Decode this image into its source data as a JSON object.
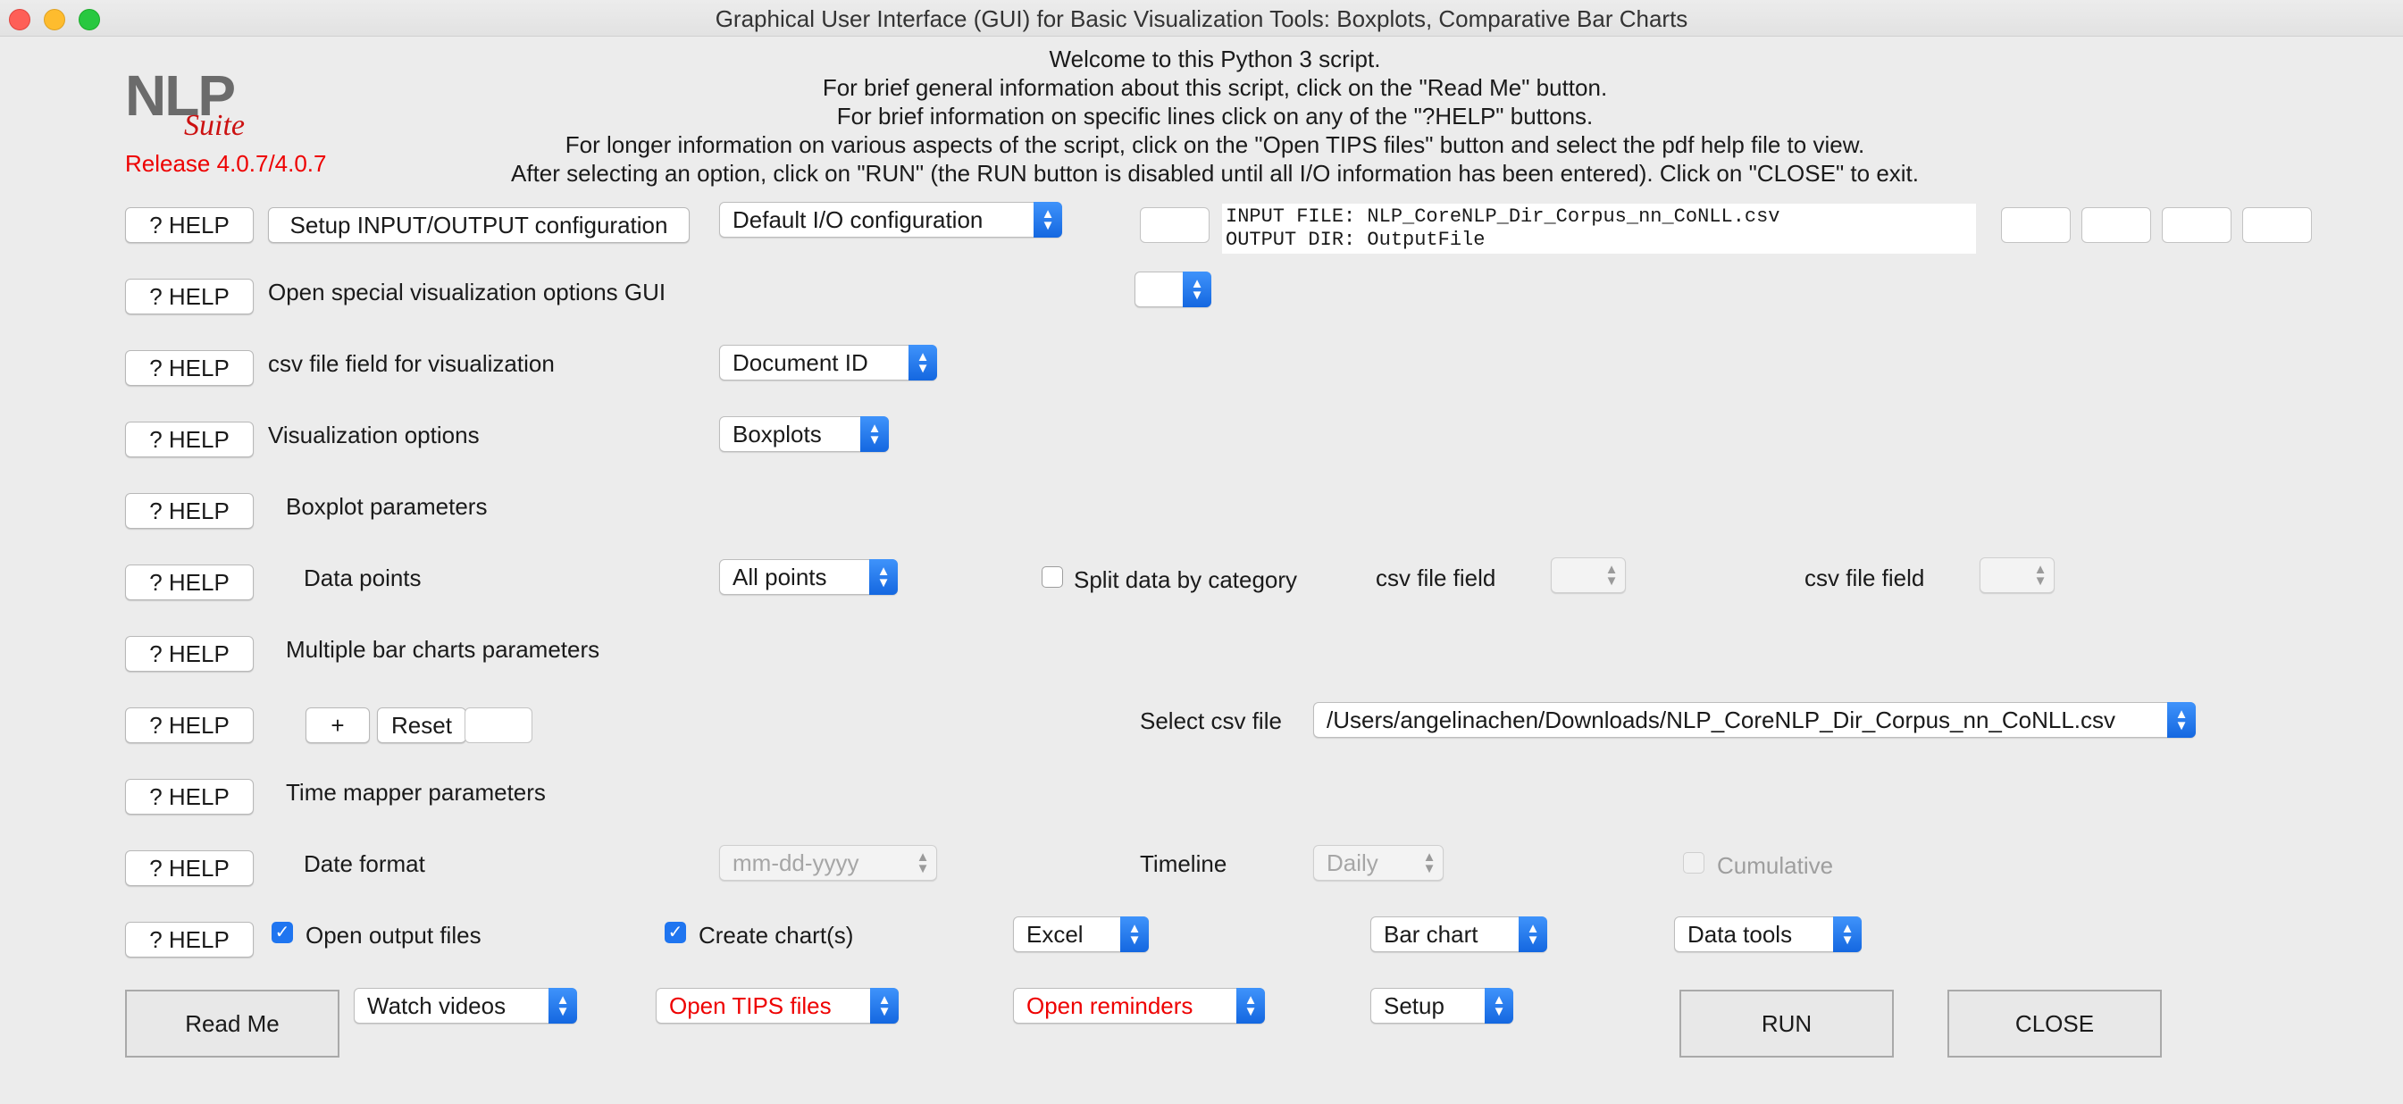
{
  "window": {
    "title": "Graphical User Interface (GUI) for Basic Visualization Tools: Boxplots, Comparative Bar Charts"
  },
  "logo": {
    "nlp": "NLP",
    "suite": "Suite"
  },
  "release": "Release 4.0.7/4.0.7",
  "header_lines": [
    "Welcome to this Python 3 script.",
    "For brief general information about this script, click on the \"Read Me\" button.",
    "For brief information on specific lines click on any of the \"?HELP\" buttons.",
    "For longer information on various aspects of the script, click on the \"Open TIPS files\" button and select the pdf help file to view.",
    "After selecting an option, click on \"RUN\" (the RUN button is disabled until all I/O information has been entered).   Click on \"CLOSE\" to exit."
  ],
  "help_label": "? HELP",
  "io": {
    "setup_button": "Setup INPUT/OUTPUT configuration",
    "config_select": "Default I/O configuration",
    "input_file": "INPUT FILE: NLP_CoreNLP_Dir_Corpus_nn_CoNLL.csv",
    "output_dir": "OUTPUT DIR: OutputFile"
  },
  "rows": {
    "special_options": "Open special visualization options GUI",
    "csv_field": {
      "label": "csv file field for visualization",
      "value": "Document ID"
    },
    "vis_options": {
      "label": "Visualization options",
      "value": "Boxplots"
    },
    "boxplot_params": "Boxplot parameters",
    "data_points": {
      "label": "Data points",
      "value": "All points",
      "split_label": "Split data by category",
      "split_checked": false,
      "field1_label": "csv file field",
      "field2_label": "csv file field"
    },
    "bar_params": "Multiple bar charts parameters",
    "bar_controls": {
      "plus": "+",
      "reset": "Reset",
      "select_label": "Select csv file",
      "select_value": "/Users/angelinachen/Downloads/NLP_CoreNLP_Dir_Corpus_nn_CoNLL.csv"
    },
    "time_params": "Time mapper parameters",
    "date_format": {
      "label": "Date format",
      "value": "mm-dd-yyyy",
      "timeline_label": "Timeline",
      "timeline_value": "Daily",
      "cumulative_label": "Cumulative",
      "cumulative_checked": false
    },
    "output": {
      "open_files_label": "Open output files",
      "open_files_checked": true,
      "create_charts_label": "Create chart(s)",
      "create_charts_checked": true,
      "excel": "Excel",
      "bar_chart": "Bar chart",
      "data_tools": "Data tools"
    }
  },
  "bottom": {
    "read_me": "Read Me",
    "watch_videos": "Watch videos",
    "open_tips": "Open TIPS files",
    "open_reminders": "Open reminders",
    "setup": "Setup",
    "run": "RUN",
    "close": "CLOSE"
  },
  "colors": {
    "accent": "#1f75f0",
    "warning_text": "#e00000"
  }
}
